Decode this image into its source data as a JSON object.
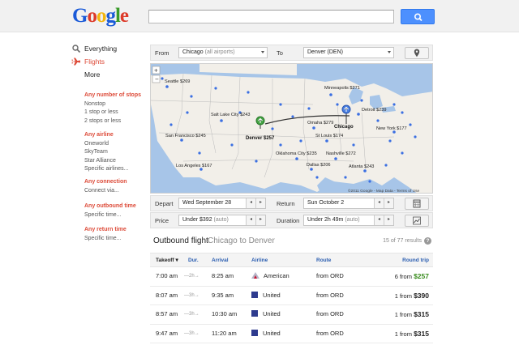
{
  "header": {
    "logo": [
      "G",
      "o",
      "o",
      "g",
      "l",
      "e"
    ],
    "logo_colors": [
      "#1a5ad8",
      "#dd3b2a",
      "#f2b50f",
      "#1a5ad8",
      "#3a9b2a",
      "#dd3b2a"
    ],
    "search_value": ""
  },
  "nav": [
    {
      "label": "Everything",
      "icon": "search-icon"
    },
    {
      "label": "Flights",
      "icon": "airplane-icon"
    },
    {
      "label": "More",
      "icon": ""
    }
  ],
  "filters": [
    {
      "title": "Any number of stops",
      "options": [
        "Nonstop",
        "1 stop or less",
        "2 stops or less"
      ]
    },
    {
      "title": "Any airline",
      "options": [
        "Oneworld",
        "SkyTeam",
        "Star Alliance",
        "Specific airlines..."
      ]
    },
    {
      "title": "Any connection",
      "options": [
        "Connect via..."
      ]
    },
    {
      "title": "Any outbound time",
      "options": [
        "Specific time..."
      ]
    },
    {
      "title": "Any return time",
      "options": [
        "Specific time..."
      ]
    }
  ],
  "route": {
    "from_label": "From",
    "from_value": "Chicago",
    "from_hint": "(all airports)",
    "to_label": "To",
    "to_value": "Denver (DEN)"
  },
  "map": {
    "cities": [
      {
        "name": "Seattle $269"
      },
      {
        "name": "Minneapolis $271"
      },
      {
        "name": "Salt Lake City $243"
      },
      {
        "name": "Omaha $279"
      },
      {
        "name": "Detroit $239"
      },
      {
        "name": "San Francisco $245"
      },
      {
        "name": "St Louis $174"
      },
      {
        "name": "New York $177"
      },
      {
        "name": "Oklahoma City $235"
      },
      {
        "name": "Nashville $272"
      },
      {
        "name": "Los Angeles $167"
      },
      {
        "name": "Dallas $206"
      },
      {
        "name": "Atlanta $243"
      }
    ],
    "destination_label": "Denver $257",
    "origin_label": "Chicago",
    "copyright": "©2011 Google - Map Data - Terms of Use"
  },
  "dates": {
    "depart_label": "Depart",
    "depart_value": "Wed September 28",
    "return_label": "Return",
    "return_value": "Sun October 2",
    "price_label": "Price",
    "price_value": "Under $392",
    "price_hint": "(auto)",
    "duration_label": "Duration",
    "duration_value": "Under 2h 49m",
    "duration_hint": "(auto)"
  },
  "results": {
    "title": "Outbound flight",
    "route": "Chicago to Denver",
    "count": "15 of 77 results",
    "columns": {
      "takeoff": "Takeoff",
      "dur": "Dur.",
      "arrival": "Arrival",
      "airline": "Airline",
      "route": "Route",
      "round_trip": "Round trip"
    },
    "rows": [
      {
        "takeoff": "7:00 am",
        "dur": "2h",
        "arrival": "8:25 am",
        "airline": "American",
        "route": "from ORD",
        "prefix": "6 from",
        "price": "$257",
        "green": true
      },
      {
        "takeoff": "8:07 am",
        "dur": "3h",
        "arrival": "9:35 am",
        "airline": "United",
        "route": "from ORD",
        "prefix": "1 from",
        "price": "$390",
        "green": false
      },
      {
        "takeoff": "8:57 am",
        "dur": "3h",
        "arrival": "10:30 am",
        "airline": "United",
        "route": "from ORD",
        "prefix": "1 from",
        "price": "$315",
        "green": false
      },
      {
        "takeoff": "9:47 am",
        "dur": "3h",
        "arrival": "11:20 am",
        "airline": "United",
        "route": "from ORD",
        "prefix": "1 from",
        "price": "$315",
        "green": false
      }
    ]
  }
}
